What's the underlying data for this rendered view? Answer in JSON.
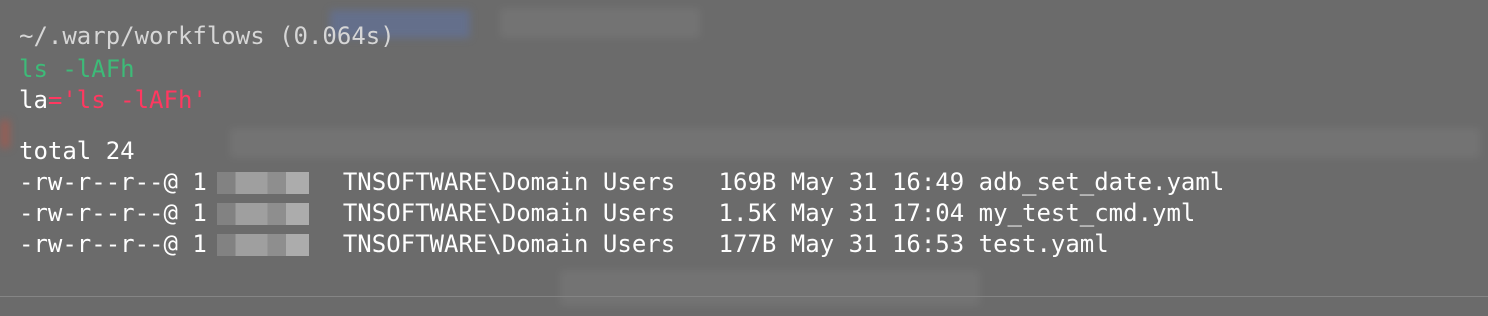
{
  "prompt": {
    "path_text": "~/.warp/workflows (0.064s)"
  },
  "command": {
    "name": "ls",
    "args": " -lAFh"
  },
  "alias_output": {
    "name": "la",
    "equals": "=",
    "value": "'ls -lAFh'"
  },
  "listing": {
    "total": "total 24",
    "rows": [
      {
        "perms": "-rw-r--r--@ 1",
        "group": "TNSOFTWARE\\Domain Users",
        "size": "169B",
        "date": "May 31 16:49",
        "file": "adb_set_date.yaml"
      },
      {
        "perms": "-rw-r--r--@ 1",
        "group": "TNSOFTWARE\\Domain Users",
        "size": "1.5K",
        "date": "May 31 17:04",
        "file": "my_test_cmd.yml"
      },
      {
        "perms": "-rw-r--r--@ 1",
        "group": "TNSOFTWARE\\Domain Users",
        "size": "177B",
        "date": "May 31 16:53",
        "file": "test.yaml"
      }
    ]
  },
  "colors": {
    "background": "#6b6b6b",
    "command": "#3dbb78",
    "alias_value": "#ff3860",
    "text": "#ffffff"
  }
}
